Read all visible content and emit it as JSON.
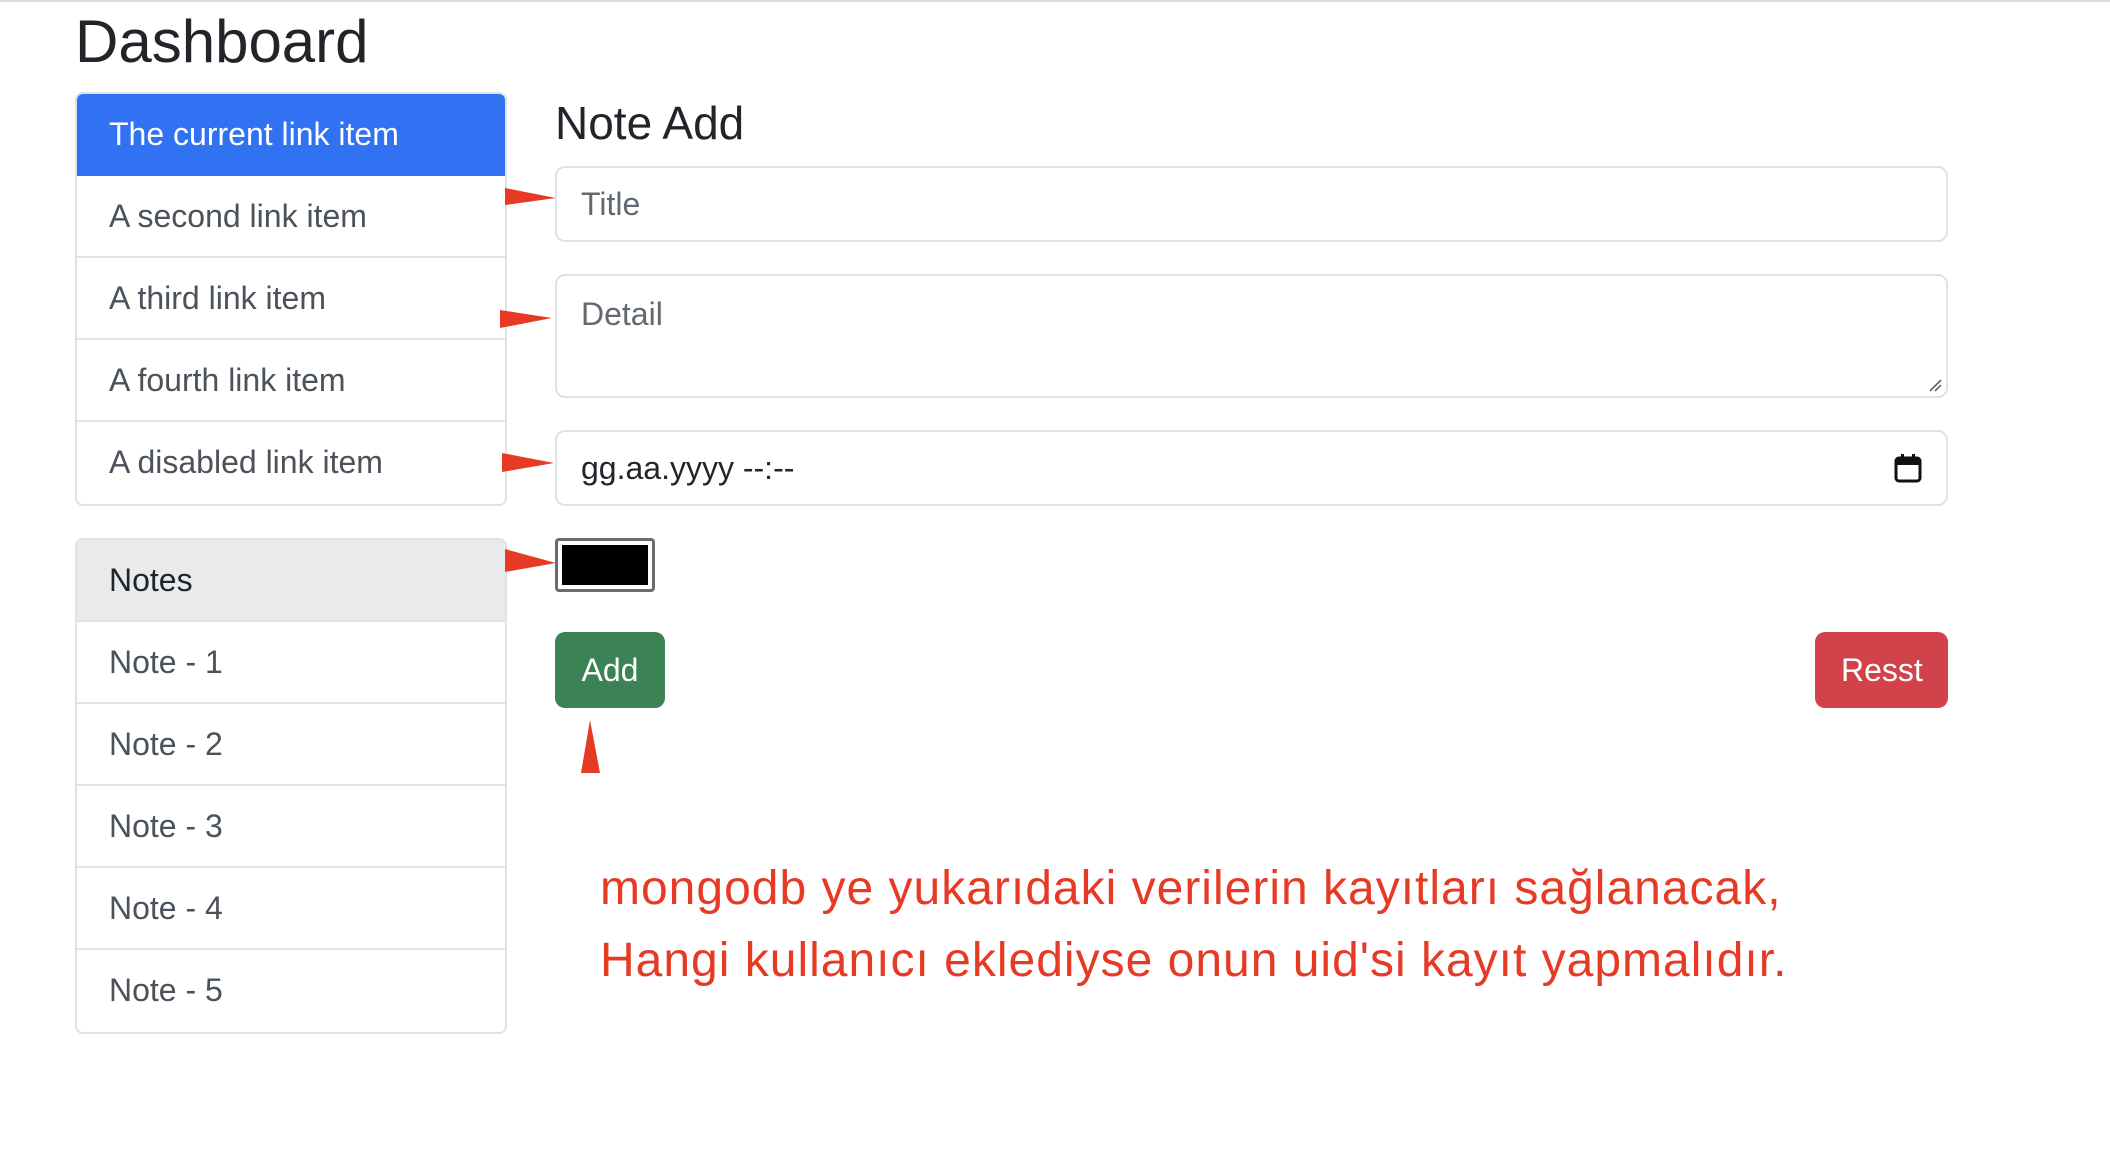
{
  "page": {
    "title": "Dashboard"
  },
  "links": {
    "items": [
      {
        "label": "The current link item",
        "active": true
      },
      {
        "label": "A second link item"
      },
      {
        "label": "A third link item"
      },
      {
        "label": "A fourth link item"
      },
      {
        "label": "A disabled link item"
      }
    ]
  },
  "notes": {
    "header": "Notes",
    "items": [
      "Note - 1",
      "Note - 2",
      "Note - 3",
      "Note - 4",
      "Note - 5"
    ]
  },
  "form": {
    "title": "Note Add",
    "title_placeholder": "Title",
    "detail_placeholder": "Detail",
    "datetime_value": "gg.aa.yyyy --:--",
    "color_value": "#000000",
    "add_label": "Add",
    "reset_label": "Resst"
  },
  "annotation": {
    "line1": "mongodb ye yukarıdaki verilerin kayıtları sağlanacak,",
    "line2": "Hangi kullanıcı eklediyse onun uid'si kayıt yapmalıdır.",
    "color": "#e63a25"
  },
  "colors": {
    "primary": "#3072f1",
    "success": "#3b8254",
    "danger": "#d2424b",
    "arrow": "#e63a25"
  }
}
